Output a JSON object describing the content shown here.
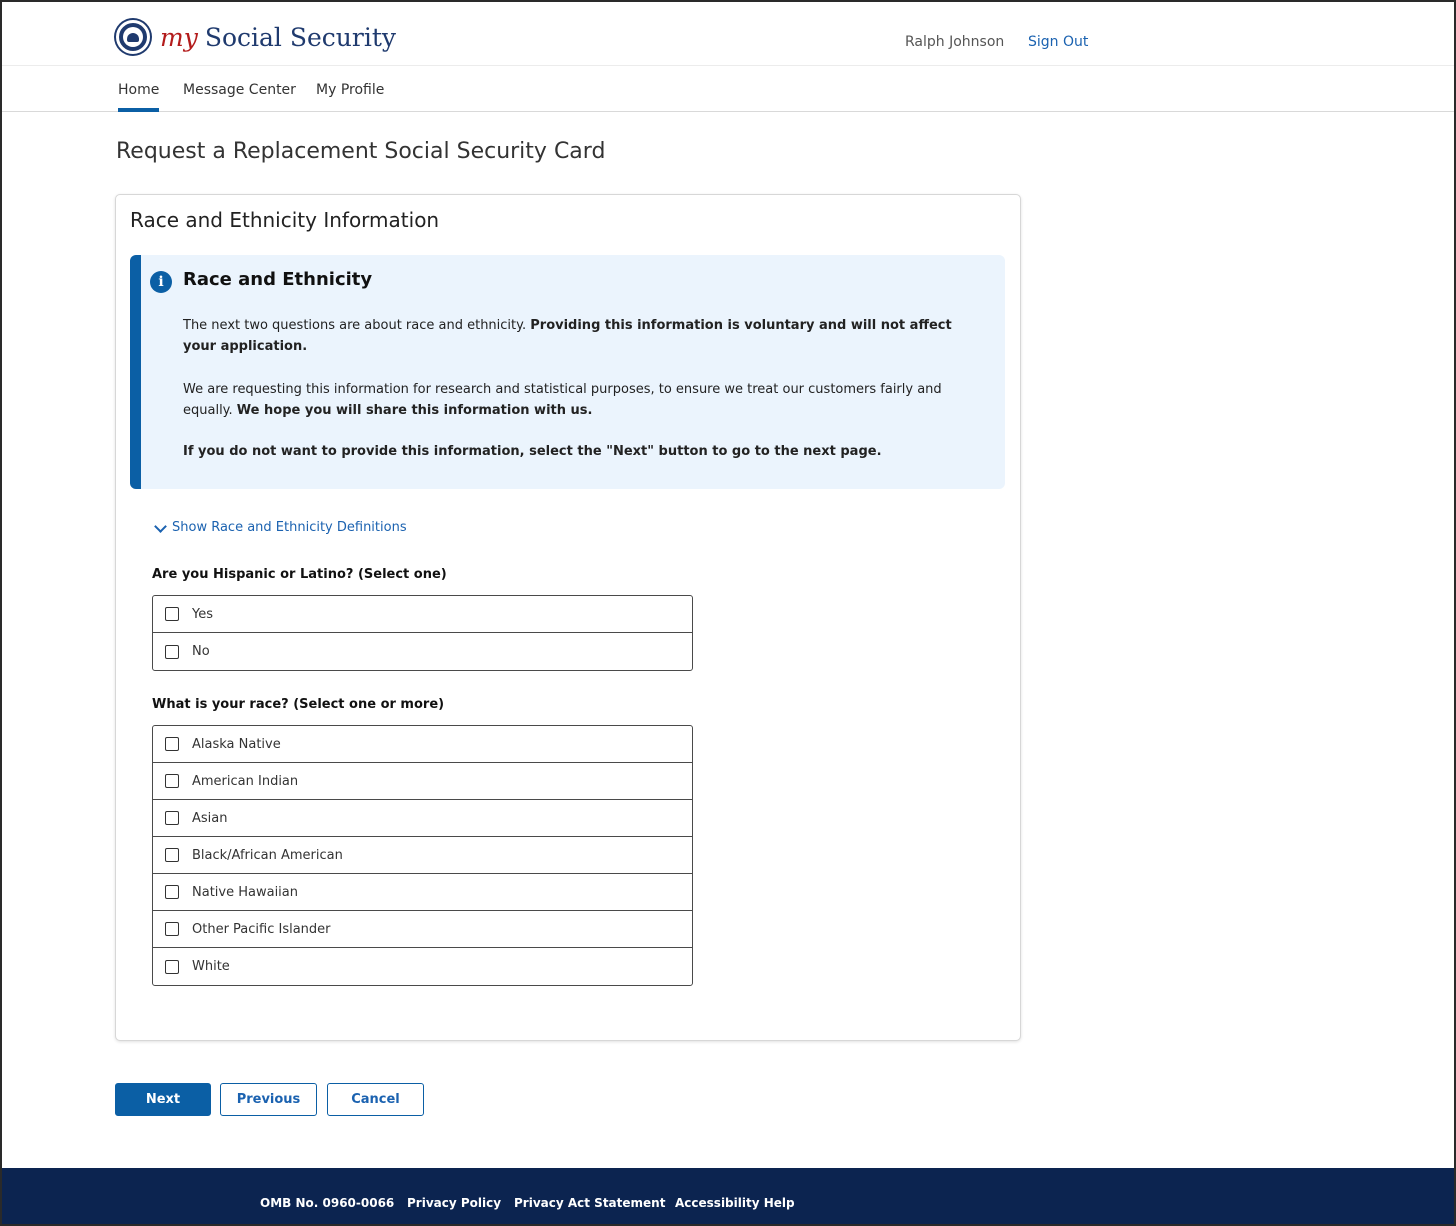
{
  "header": {
    "logo_my": "my",
    "logo_text": "Social Security",
    "user_name": "Ralph Johnson",
    "sign_out": "Sign Out"
  },
  "nav": {
    "items": [
      {
        "label": "Home",
        "active": true
      },
      {
        "label": "Message Center",
        "active": false
      },
      {
        "label": "My Profile",
        "active": false
      }
    ]
  },
  "page_title": "Request a Replacement Social Security Card",
  "card": {
    "title": "Race and Ethnicity Information",
    "info": {
      "title": "Race and Ethnicity",
      "p1_text": "The next two questions are about race and ethnicity. ",
      "p1_bold": "Providing this information is voluntary and will not affect your application.",
      "p2_text": "We are requesting this information for research and statistical purposes, to ensure we treat our customers fairly and equally. ",
      "p2_bold": "We hope you will share this information with us.",
      "p3_bold": "If you do not want to provide this information, select the \"Next\" button to go to the next page."
    },
    "show_definitions": "Show Race and Ethnicity Definitions",
    "q1": {
      "label": "Are you Hispanic or Latino? (Select one)",
      "options": [
        "Yes",
        "No"
      ]
    },
    "q2": {
      "label": "What is your race? (Select one or more)",
      "options": [
        "Alaska Native",
        "American Indian",
        "Asian",
        "Black/African American",
        "Native Hawaiian",
        "Other Pacific Islander",
        "White"
      ]
    }
  },
  "buttons": {
    "next": "Next",
    "previous": "Previous",
    "cancel": "Cancel"
  },
  "footer": {
    "omb": "OMB No. 0960-0066",
    "privacy_policy": "Privacy Policy",
    "privacy_act": "Privacy Act Statement",
    "accessibility": "Accessibility Help"
  },
  "colors": {
    "brand_blue": "#0b5fa5",
    "link_blue": "#1b62b0",
    "footer_navy": "#0c2450",
    "info_bg": "#ebf4fd",
    "logo_red": "#b31b1b"
  }
}
